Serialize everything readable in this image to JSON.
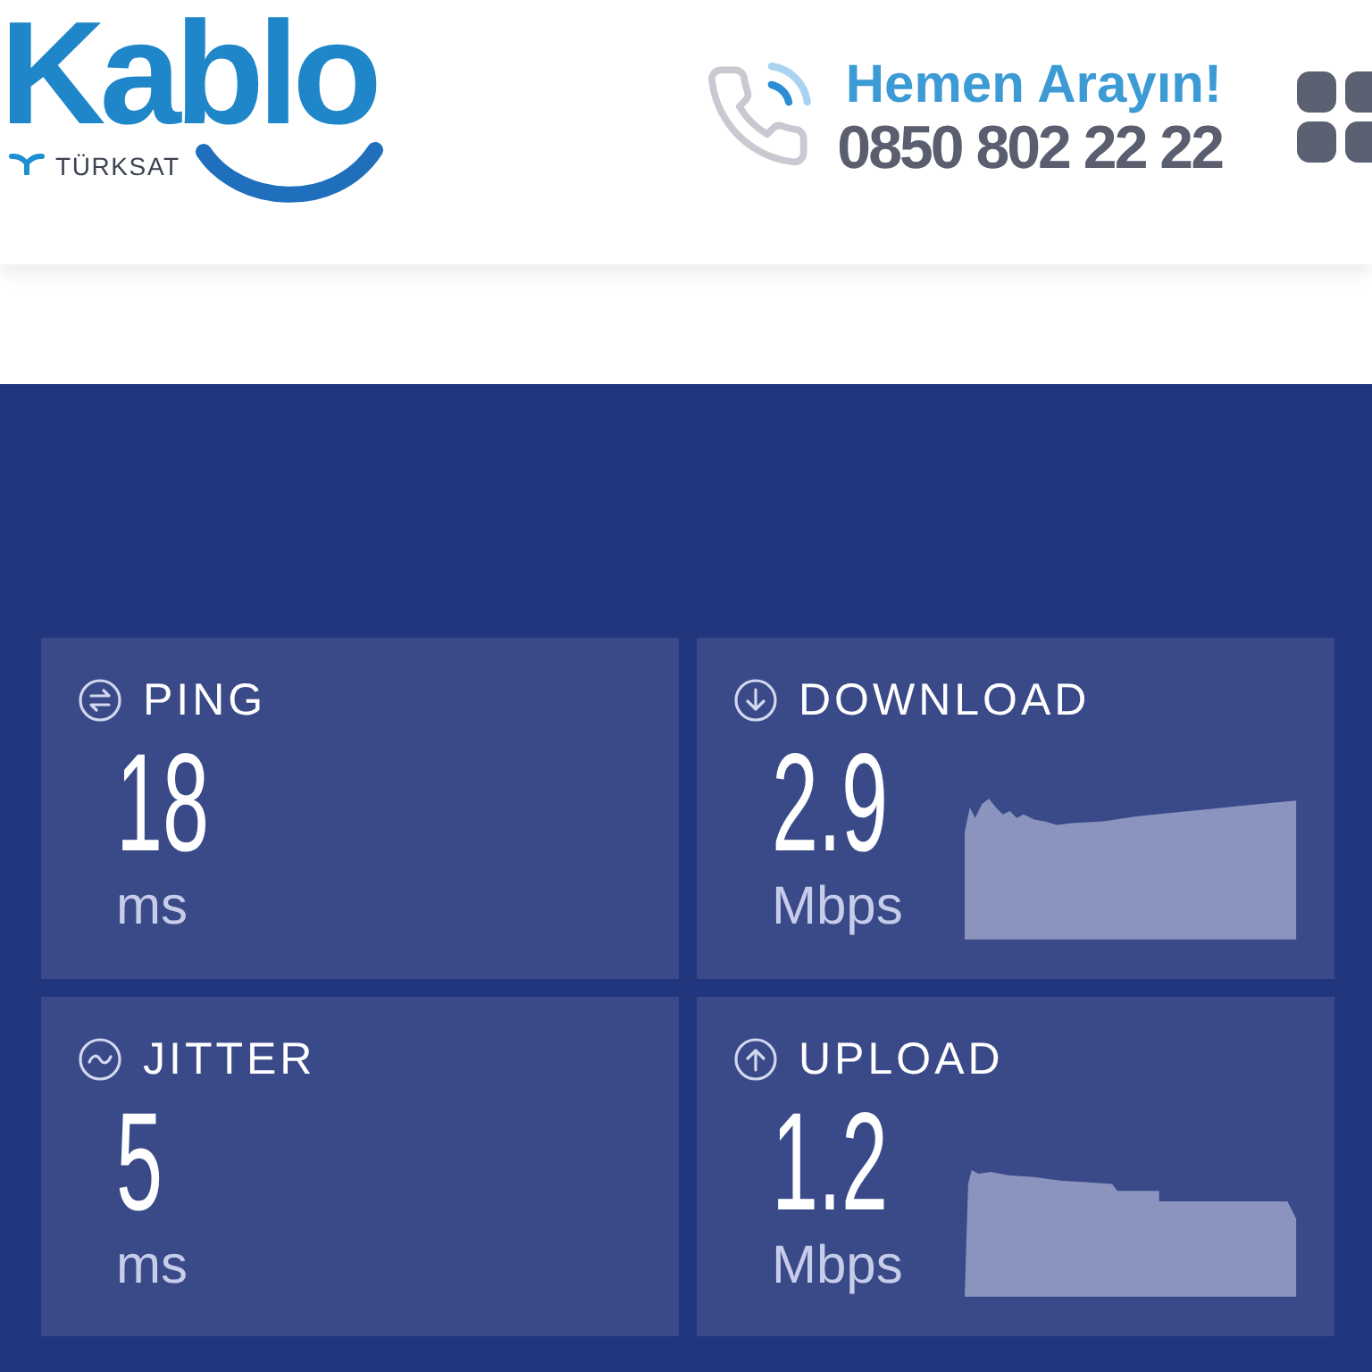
{
  "header": {
    "logo": {
      "wordmark": "Kablo",
      "brand": "TÜRKSAT"
    },
    "contact": {
      "prompt": "Hemen Arayın!",
      "phone": "0850 802 22 22"
    }
  },
  "metrics": [
    {
      "kind": "ping",
      "label": "PING",
      "value": "18",
      "unit": "ms"
    },
    {
      "kind": "download",
      "label": "DOWNLOAD",
      "value": "2.9",
      "unit": "Mbps"
    },
    {
      "kind": "jitter",
      "label": "JITTER",
      "value": "5",
      "unit": "ms"
    },
    {
      "kind": "upload",
      "label": "UPLOAD",
      "value": "1.2",
      "unit": "Mbps"
    }
  ]
}
